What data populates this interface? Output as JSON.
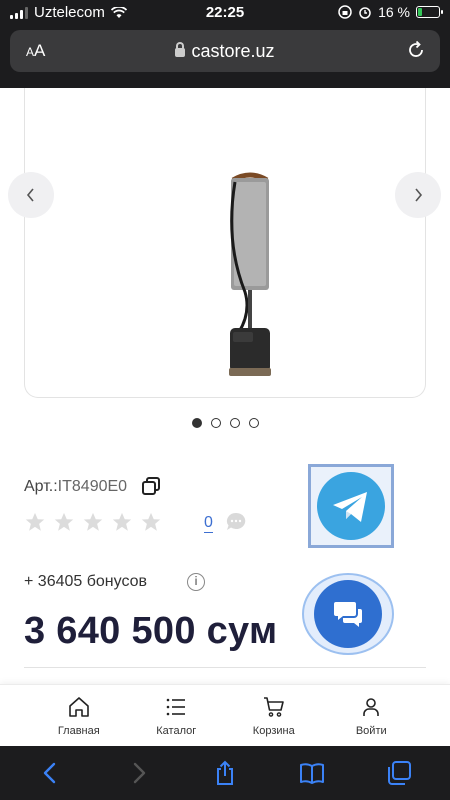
{
  "status_bar": {
    "carrier": "Uztelecom",
    "time": "22:25",
    "battery_percent_label": "16 %",
    "battery_level": 0.16
  },
  "browser": {
    "text_size_label": "AA",
    "domain": "castore.uz",
    "reload_icon": "reload-icon",
    "lock_icon": "lock-icon"
  },
  "gallery": {
    "prev_icon": "chevron-left-icon",
    "next_icon": "chevron-right-icon",
    "dot_count": 4,
    "active_dot": 0
  },
  "product": {
    "sku_label": "Арт.:",
    "sku_value": "IT8490E0",
    "rating": 0,
    "rating_max": 5,
    "review_count": "0",
    "bonus_text": "+ 36405 бонусов",
    "info_glyph": "i",
    "price": "3 640 500 сум"
  },
  "floating": {
    "telegram_icon": "telegram-icon",
    "chat_icon": "chat-icon"
  },
  "bottom_nav": [
    {
      "label": "Главная",
      "icon": "home-icon"
    },
    {
      "label": "Каталог",
      "icon": "catalog-icon"
    },
    {
      "label": "Корзина",
      "icon": "cart-icon"
    },
    {
      "label": "Войти",
      "icon": "user-icon"
    }
  ],
  "toolbar": {
    "back_icon": "back-icon",
    "forward_icon": "forward-icon",
    "share_icon": "share-icon",
    "bookmarks_icon": "bookmarks-icon",
    "tabs_icon": "tabs-icon"
  },
  "colors": {
    "accent": "#3d6fd1",
    "price": "#1f1f3a",
    "telegram": "#3aa4e0",
    "chat": "#2f6fd0",
    "toolbar_icon": "#3b82f6"
  }
}
